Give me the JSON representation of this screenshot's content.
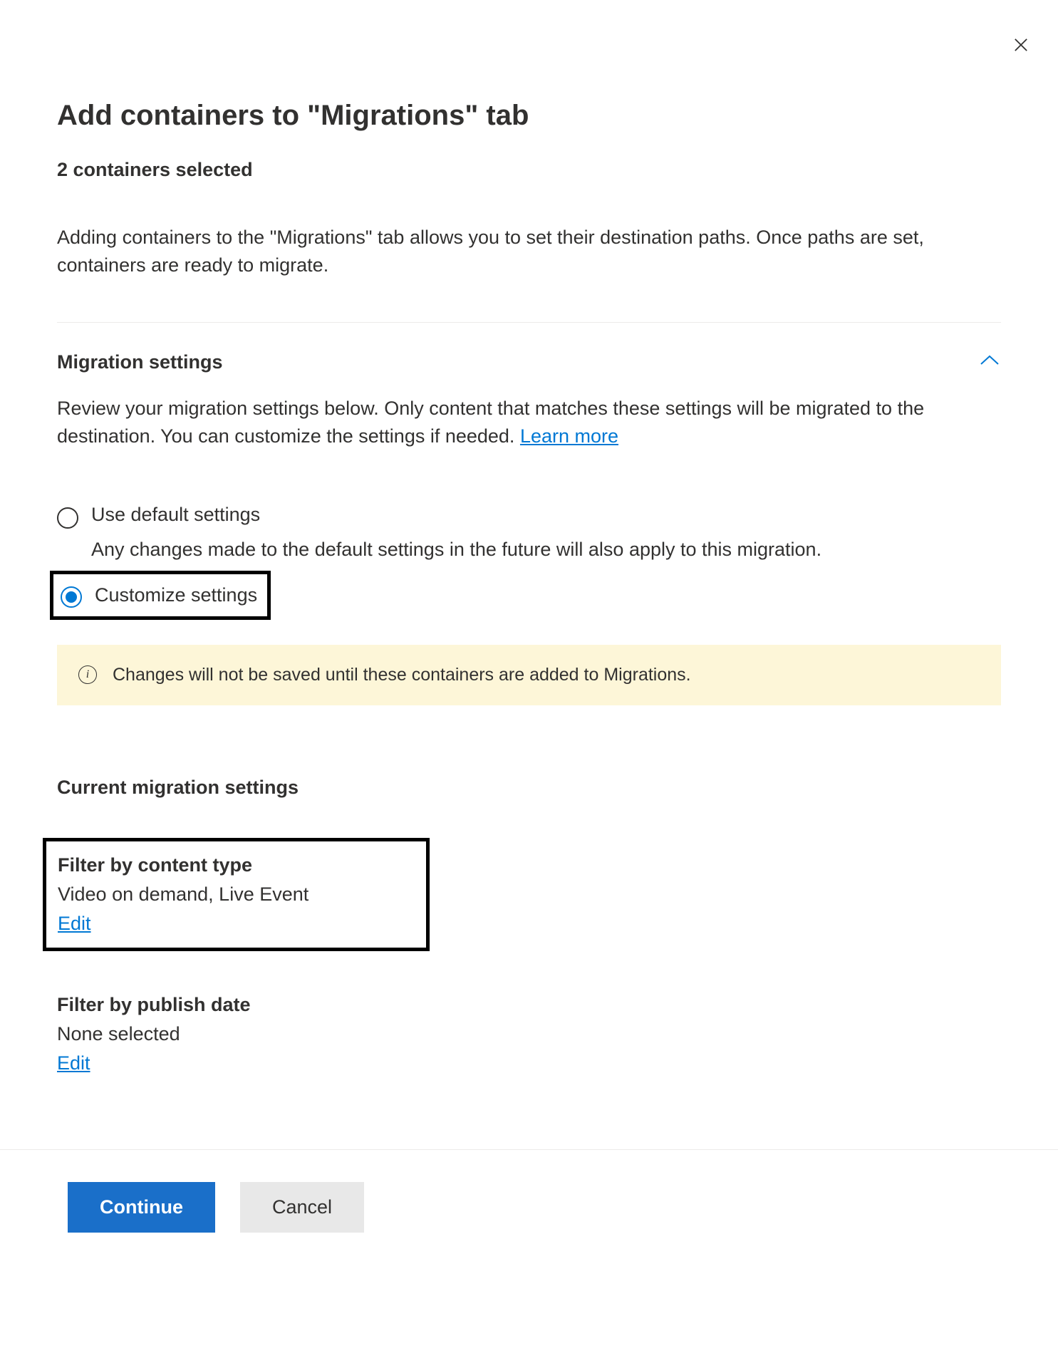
{
  "close_label": "×",
  "page_title": "Add containers to \"Migrations\" tab",
  "selection_count": "2 containers selected",
  "description": "Adding containers to the \"Migrations\" tab allows you to set their destination paths. Once paths are set, containers are ready to migrate.",
  "migration_settings": {
    "title": "Migration settings",
    "description_part1": "Review your migration settings below. Only content that matches these settings will be migrated to the destination. You can customize the settings if needed. ",
    "learn_more": "Learn more",
    "options": {
      "default": {
        "label": "Use default settings",
        "subtext": "Any changes made to the default settings in the future will also apply to this migration."
      },
      "customize": {
        "label": "Customize settings"
      }
    },
    "info_banner": "Changes will not be saved until these containers are added to Migrations."
  },
  "current_settings": {
    "title": "Current migration settings",
    "filter_content_type": {
      "label": "Filter by content type",
      "value": "Video on demand, Live Event",
      "edit": "Edit"
    },
    "filter_publish_date": {
      "label": "Filter by publish date",
      "value": "None selected",
      "edit": "Edit"
    }
  },
  "footer": {
    "continue": "Continue",
    "cancel": "Cancel"
  }
}
